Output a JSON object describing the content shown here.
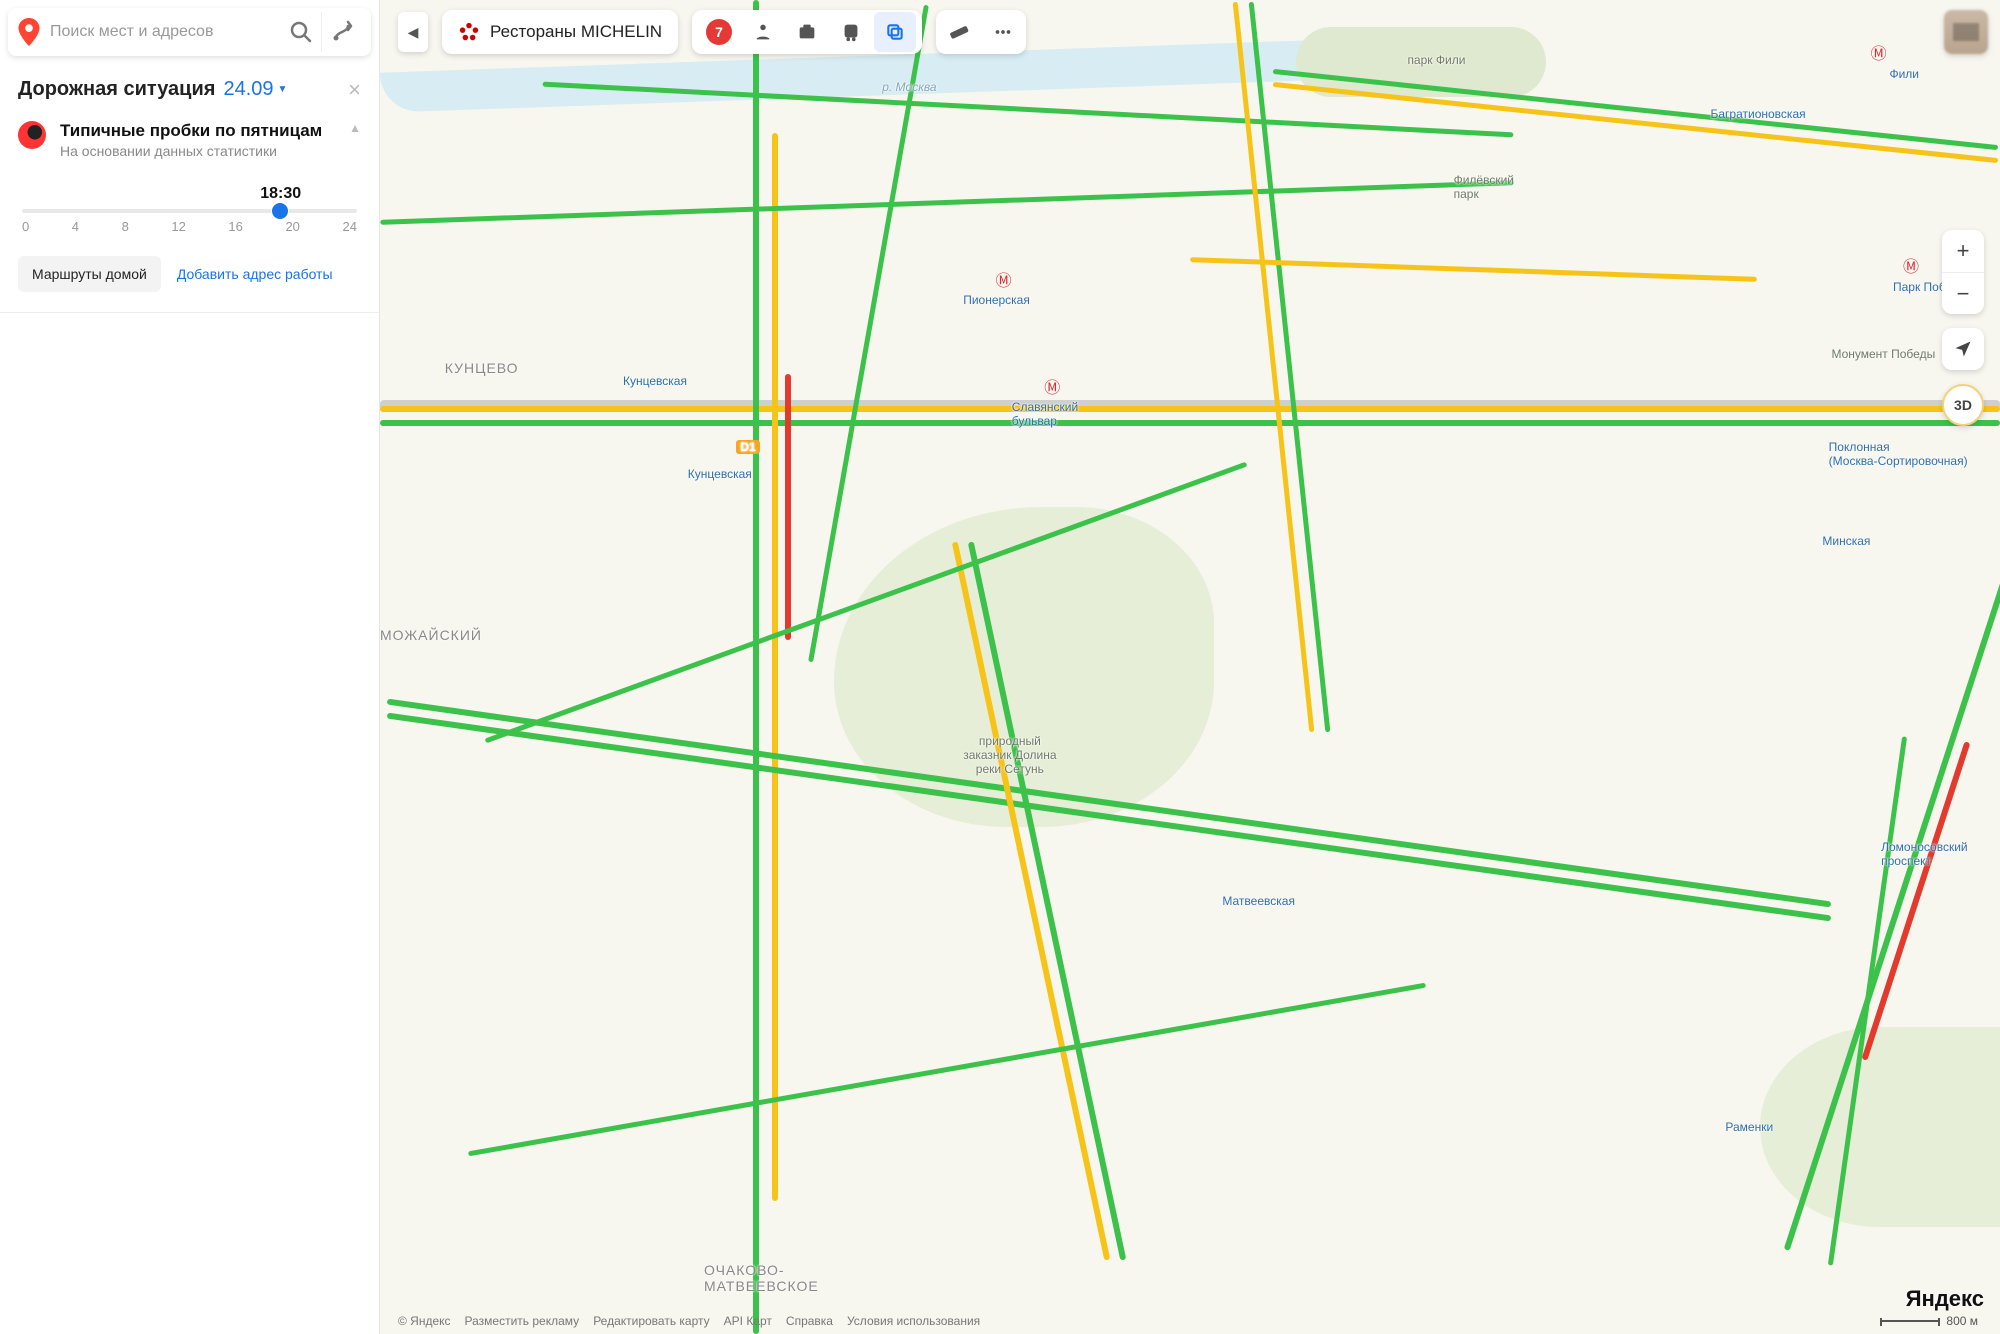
{
  "search": {
    "placeholder": "Поиск мест и адресов"
  },
  "panel": {
    "title": "Дорожная ситуация",
    "date": "24.09",
    "traffic_heading": "Типичные пробки по пятницам",
    "traffic_sub": "На основании данных статистики",
    "selected_time": "18:30",
    "slider": {
      "ticks": [
        "0",
        "4",
        "8",
        "12",
        "16",
        "20",
        "24"
      ],
      "value_hour": 18.5,
      "max_hour": 24
    },
    "btn_home": "Маршруты домой",
    "btn_work": "Добавить адрес работы"
  },
  "topbar": {
    "michelin_label": "Рестораны MICHELIN",
    "traffic_level": "7"
  },
  "labels": {
    "park_fili": "парк Фили",
    "bagration": "Багратионовская",
    "fili_metro": "Фили",
    "filevsky_park": "Филёвский\nпарк",
    "pionerskaya": "Пионерская",
    "kuntsevo": "КУНЦЕВО",
    "kuntsevskaya": "Кунцевская",
    "kuntsevskaya2": "Кунцевская",
    "slavyansky": "Славянский\nбульвар",
    "park_pobedy": "Парк Победы",
    "monument": "Монумент Победы",
    "poklonnaya": "Поклонная\n(Москва-Сортировочная)",
    "minskaya": "Минская",
    "setun": "природный\nзаказник Долина\nреки Сетунь",
    "matveevskaya": "Матвеевская",
    "lomonosovsky": "Ломоносовский\nпроспект",
    "ramenki": "Раменки",
    "ochakovo": "ОЧАКОВО-\nМАТВЕЕВСКОЕ",
    "mozhaisky": "МОЖАЙСКИЙ",
    "moskva_river": "р. Москва",
    "d1_badge": "D1"
  },
  "right": {
    "dim_label": "3D"
  },
  "footer": {
    "copyright": "© Яндекс",
    "links": [
      "Разместить рекламу",
      "Редактировать карту",
      "API Карт",
      "Справка",
      "Условия использования"
    ],
    "brand": "Яндекс",
    "scale": "800 м"
  }
}
